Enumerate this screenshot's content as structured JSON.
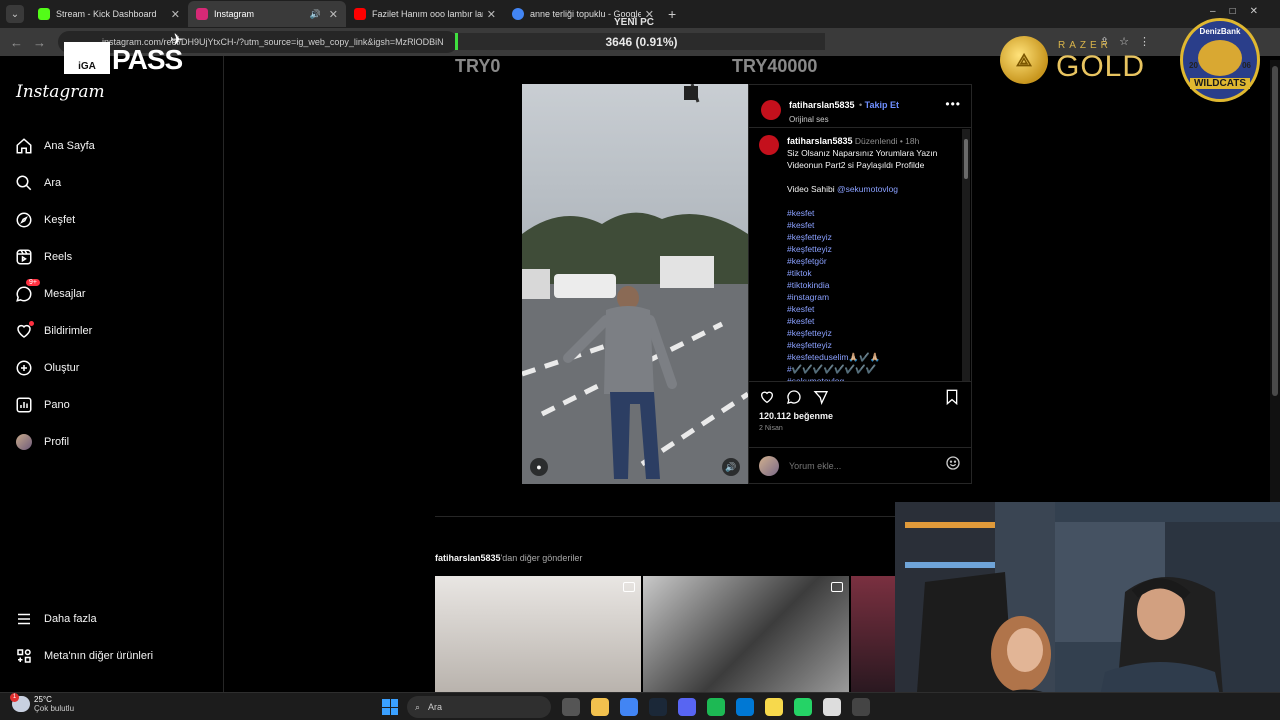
{
  "browser": {
    "tabs": [
      {
        "title": "Stream - Kick Dashboard",
        "favicon_color": "#53fc18",
        "active": false
      },
      {
        "title": "Instagram",
        "favicon_color": "#d62976",
        "active": true
      },
      {
        "title": "Fazilet Hanım ooo lambır lamb",
        "favicon_color": "#ff0000",
        "active": false
      },
      {
        "title": "anne terliği topuklu - Google'd",
        "favicon_color": "#4285f4",
        "active": false
      }
    ],
    "url": "instagram.com/reel/DH9UjYtxCH-/?utm_source=ig_web_copy_link&igsh=MzRlODBiN"
  },
  "overlays": {
    "iga_box": "iGA",
    "iga_pass": "PASS",
    "yeni_pc": "YENİ PC",
    "donation_progress": "3646 (0.91%)",
    "try_start": "TRY0",
    "try_goal": "TRY40000",
    "razer_brand": "RAZER",
    "razer_gold": "GOLD",
    "badge_bank": "DenizBank",
    "badge_year_left": "20",
    "badge_year_right": "06",
    "badge_team": "WILDCATS"
  },
  "sidebar": {
    "logo": "Instagram",
    "items": [
      {
        "label": "Ana Sayfa",
        "icon": "home-icon"
      },
      {
        "label": "Ara",
        "icon": "search-icon"
      },
      {
        "label": "Keşfet",
        "icon": "compass-icon"
      },
      {
        "label": "Reels",
        "icon": "reels-icon"
      },
      {
        "label": "Mesajlar",
        "icon": "messenger-icon",
        "badge": "9+"
      },
      {
        "label": "Bildirimler",
        "icon": "heart-icon"
      },
      {
        "label": "Oluştur",
        "icon": "plus-square-icon"
      },
      {
        "label": "Pano",
        "icon": "dashboard-icon"
      },
      {
        "label": "Profil",
        "icon": "avatar"
      }
    ],
    "bottom": [
      {
        "label": "Daha fazla",
        "icon": "menu-icon"
      },
      {
        "label": "Meta'nın diğer ürünleri",
        "icon": "grid-icon"
      }
    ]
  },
  "post": {
    "username": "fatiharslan5835",
    "follow_label": "Takip Et",
    "audio": "Orijinal ses",
    "caption_user": "fatiharslan5835",
    "edited": "Düzenlendi",
    "age": "18h",
    "caption_line1": "Siz Olsanız Naparsınız Yorumlara Yazın",
    "caption_line2": "Videonun Part2 si Paylaşıldı Profilde",
    "caption_owner_prefix": "Video Sahibi",
    "caption_owner_link": "@sekumotovlog",
    "hashtags": [
      "#kesfet",
      "#kesfet",
      "#keşfetteyiz",
      "#keşfetteyiz",
      "#keşfetgör",
      "#tiktok",
      "#tiktokindia",
      "#instagram",
      "#kesfet",
      "#kesfet",
      "#keşfetteyiz",
      "#keşfetteyiz",
      "#kesfeteduselim🙏🏼✔️🙏🏼",
      "#✔️✔️✔️✔️✔️✔️✔️✔️",
      "#sekumotovlog"
    ],
    "likes": "120.112 beğenme",
    "date": "2 Nisan",
    "comment_placeholder": "Yorum ekle..."
  },
  "more_posts": {
    "user": "fatiharslan5835",
    "suffix": "'dan diğer gönderiler"
  },
  "taskbar": {
    "weather_badge": "1",
    "temp": "25°C",
    "condition": "Çok bulutlu",
    "search": "Ara",
    "apps": [
      {
        "name": "taskview-icon",
        "color": "#555555"
      },
      {
        "name": "file-explorer-icon",
        "color": "#f2c14e"
      },
      {
        "name": "chrome-icon",
        "color": "#4285f4"
      },
      {
        "name": "steam-icon",
        "color": "#1b2838"
      },
      {
        "name": "discord-icon",
        "color": "#5865f2"
      },
      {
        "name": "spotify-icon",
        "color": "#1db954"
      },
      {
        "name": "outlook-icon",
        "color": "#0078d4"
      },
      {
        "name": "sticky-notes-icon",
        "color": "#f7d94c"
      },
      {
        "name": "whatsapp-icon",
        "color": "#25d366"
      },
      {
        "name": "chatgpt-icon",
        "color": "#dddddd"
      },
      {
        "name": "xbox-icon",
        "color": "#444444"
      }
    ]
  }
}
